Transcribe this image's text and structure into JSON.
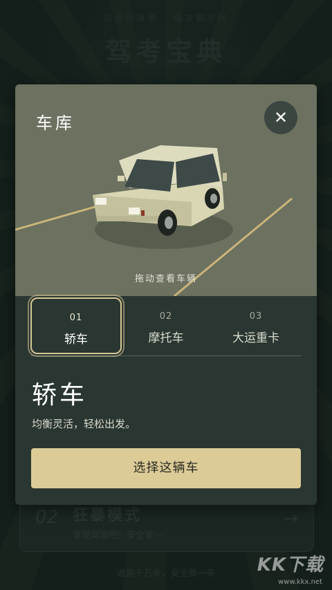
{
  "background": {
    "tagline": "沿途皆风景 · 每次都不同",
    "app_title": "驾考宝典",
    "mode_card": {
      "number": "02",
      "title": "狂暴模式",
      "subtitle": "享受驾驶吧！安全第一",
      "arrow": "→"
    },
    "footer": "道路千万条，安全第一条",
    "watermark": "KK下载",
    "watermark_url": "www.kkx.net"
  },
  "modal": {
    "title": "车库",
    "close_label": "✕",
    "drag_hint": "拖动查看车辆",
    "tabs": [
      {
        "num": "01",
        "label": "轿车",
        "active": true
      },
      {
        "num": "02",
        "label": "摩托车",
        "active": false
      },
      {
        "num": "03",
        "label": "大运重卡",
        "active": false
      }
    ],
    "selected_name": "轿车",
    "selected_desc": "均衡灵活，轻松出发。",
    "select_button": "选择这辆车"
  },
  "colors": {
    "accent": "#dccb97",
    "viewer_bg": "#6c7160",
    "modal_bg": "#2a3631",
    "page_bg": "#1b2723"
  }
}
